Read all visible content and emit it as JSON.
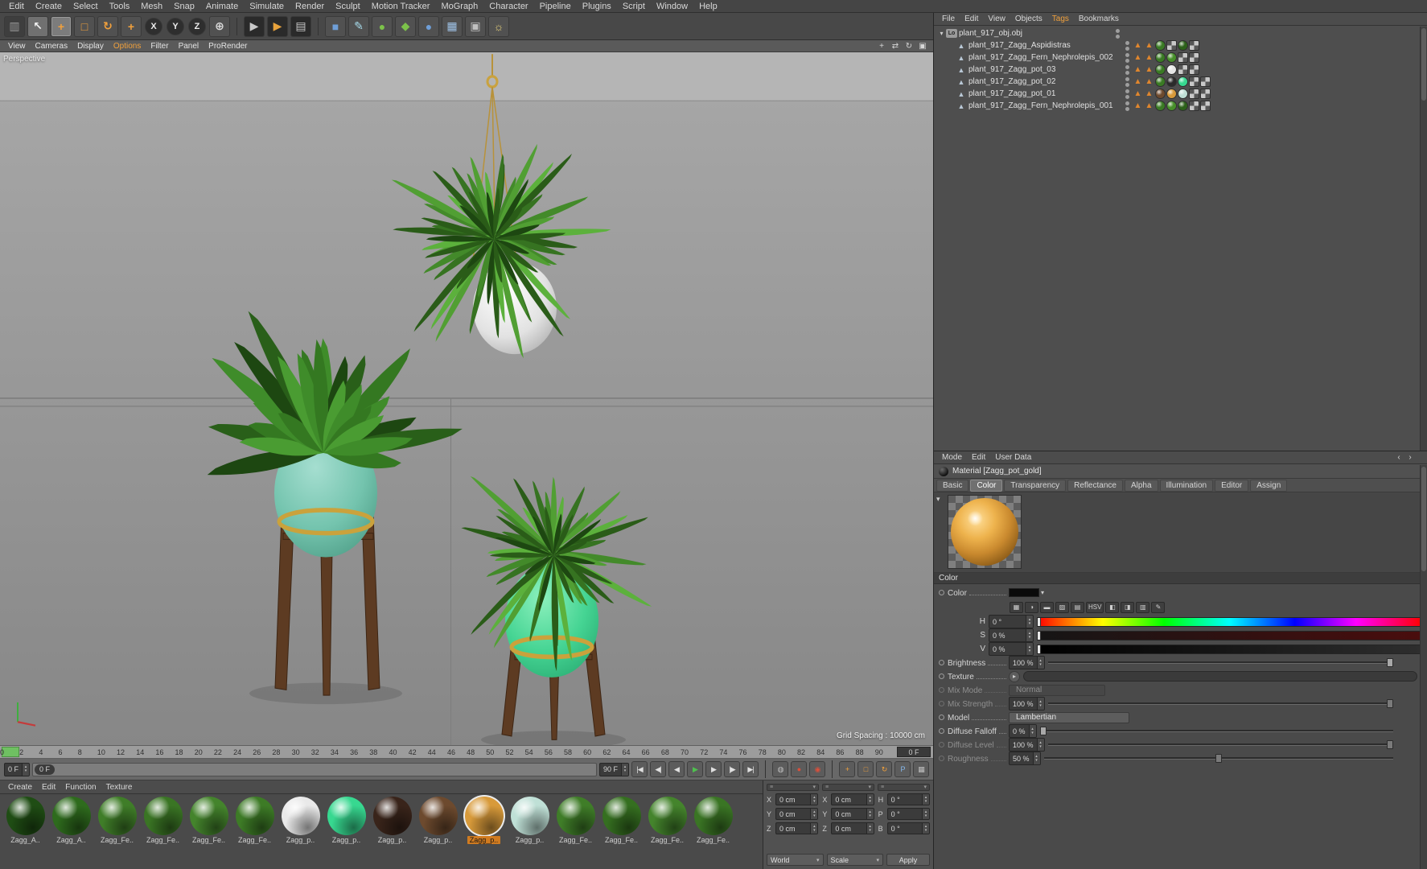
{
  "menubar": {
    "items": [
      "Edit",
      "Create",
      "Select",
      "Tools",
      "Mesh",
      "Snap",
      "Animate",
      "Simulate",
      "Render",
      "Sculpt",
      "Motion Tracker",
      "MoGraph",
      "Character",
      "Pipeline",
      "Plugins",
      "Script",
      "Window",
      "Help"
    ]
  },
  "toolbar": {
    "icons": [
      {
        "name": "paste-icon",
        "glyph": "▥",
        "fg": "#9a9a9a",
        "bg": "#3e3e3e"
      },
      {
        "name": "live-selection-tool",
        "glyph": "↖",
        "fg": "#f0f0f0",
        "bg": "#707070"
      },
      {
        "name": "move-tool",
        "glyph": "+",
        "fg": "#f2a13c",
        "bg": "#7c7c7c",
        "active": true
      },
      {
        "name": "scale-tool",
        "glyph": "□",
        "fg": "#f2a13c",
        "bg": "#515151"
      },
      {
        "name": "rotate-tool",
        "glyph": "↻",
        "fg": "#f2a13c",
        "bg": "#515151"
      },
      {
        "name": "last-used-tool",
        "glyph": "+",
        "fg": "#f2a13c",
        "bg": "#515151"
      },
      {
        "name": "lock-x-axis-button",
        "glyph": "X",
        "fg": "#ececec",
        "bg": "#2e2e2e",
        "round": true
      },
      {
        "name": "lock-y-axis-button",
        "glyph": "Y",
        "fg": "#ececec",
        "bg": "#2e2e2e",
        "round": true
      },
      {
        "name": "lock-z-axis-button",
        "glyph": "Z",
        "fg": "#ececec",
        "bg": "#2e2e2e",
        "round": true
      },
      {
        "name": "coordinate-system-button",
        "glyph": "⊕",
        "fg": "#dcdcdc",
        "bg": "#515151"
      },
      {
        "name": "sep"
      },
      {
        "name": "render-view-button",
        "glyph": "▶",
        "fg": "#c8c8c8",
        "bg": "#2a2a2a"
      },
      {
        "name": "render-picture-viewer-button",
        "glyph": "▶",
        "fg": "#e8a33c",
        "bg": "#2a2a2a"
      },
      {
        "name": "render-settings-button",
        "glyph": "▤",
        "fg": "#c8c8c8",
        "bg": "#2a2a2a"
      },
      {
        "name": "sep"
      },
      {
        "name": "add-cube-button",
        "glyph": "■",
        "fg": "#6f9fd8",
        "bg": "#515151"
      },
      {
        "name": "add-spline-button",
        "glyph": "✎",
        "fg": "#a8dcec",
        "bg": "#515151"
      },
      {
        "name": "add-mograph-button",
        "glyph": "●",
        "fg": "#7cc24a",
        "bg": "#515151"
      },
      {
        "name": "add-field-button",
        "glyph": "◆",
        "fg": "#7cc24a",
        "bg": "#515151"
      },
      {
        "name": "add-subdivision-button",
        "glyph": "●",
        "fg": "#6f9fd8",
        "bg": "#515151"
      },
      {
        "name": "add-instance-button",
        "glyph": "▦",
        "fg": "#9fc3e8",
        "bg": "#515151"
      },
      {
        "name": "add-camera-button",
        "glyph": "▣",
        "fg": "#c0c0c0",
        "bg": "#515151"
      },
      {
        "name": "add-light-button",
        "glyph": "☼",
        "fg": "#e8d27c",
        "bg": "#515151"
      }
    ]
  },
  "viewport": {
    "menu": [
      {
        "label": "View"
      },
      {
        "label": "Cameras"
      },
      {
        "label": "Display"
      },
      {
        "label": "Options",
        "active": true
      },
      {
        "label": "Filter"
      },
      {
        "label": "Panel"
      },
      {
        "label": "ProRender"
      }
    ],
    "corner_icons": [
      {
        "name": "pan-view-icon",
        "glyph": "+"
      },
      {
        "name": "dolly-view-icon",
        "glyph": "⇄"
      },
      {
        "name": "rotate-view-icon",
        "glyph": "↻"
      },
      {
        "name": "maximize-view-icon",
        "glyph": "▣"
      }
    ],
    "label": "Perspective",
    "grid_spacing": "Grid Spacing : 10000 cm"
  },
  "timeline": {
    "start": 0,
    "end": 90,
    "step": 2,
    "frame_box": "0 F"
  },
  "transport": {
    "current": "0 F",
    "bubble": "0 F",
    "end": "90 F",
    "buttons": [
      {
        "name": "goto-start-button",
        "glyph": "|◀"
      },
      {
        "name": "prev-key-button",
        "glyph": "◀|"
      },
      {
        "name": "prev-frame-button",
        "glyph": "◀"
      },
      {
        "name": "play-button",
        "glyph": "▶",
        "color": "#4fc04f"
      },
      {
        "name": "next-frame-button",
        "glyph": "▶"
      },
      {
        "name": "next-key-button",
        "glyph": "|▶"
      },
      {
        "name": "goto-end-button",
        "glyph": "▶|"
      }
    ],
    "record_buttons": [
      {
        "name": "keyframe-selection-button",
        "glyph": "◍",
        "color": "#c0c0c0"
      },
      {
        "name": "record-objects-button",
        "glyph": "●",
        "color": "#d8503c"
      },
      {
        "name": "autokeying-button",
        "glyph": "◉",
        "color": "#d8503c"
      }
    ],
    "key_toggles": [
      {
        "name": "keyframe-position-toggle",
        "glyph": "+",
        "color": "#f2a13c"
      },
      {
        "name": "keyframe-scale-toggle",
        "glyph": "□",
        "color": "#f2a13c"
      },
      {
        "name": "keyframe-rotation-toggle",
        "glyph": "↻",
        "color": "#f2a13c"
      },
      {
        "name": "keyframe-parameter-toggle",
        "glyph": "P",
        "color": "#86b8ec"
      },
      {
        "name": "keyframe-pla-toggle",
        "glyph": "▦",
        "color": "#c0c0c0"
      }
    ]
  },
  "materials": {
    "menu": [
      "Create",
      "Edit",
      "Function",
      "Texture"
    ],
    "items": [
      {
        "label": "Zagg_A..",
        "color": "#1f4d14"
      },
      {
        "label": "Zagg_A..",
        "color": "#2e6b1d"
      },
      {
        "label": "Zagg_Fe..",
        "color": "#3f7d28"
      },
      {
        "label": "Zagg_Fe..",
        "color": "#3a7524"
      },
      {
        "label": "Zagg_Fe..",
        "color": "#44842c"
      },
      {
        "label": "Zagg_Fe..",
        "color": "#3d7b26"
      },
      {
        "label": "Zagg_p..",
        "color": "#e9e9e9"
      },
      {
        "label": "Zagg_p..",
        "color": "#37d890"
      },
      {
        "label": "Zagg_p..",
        "color": "#39241a"
      },
      {
        "label": "Zagg_p..",
        "color": "#6d4a2e"
      },
      {
        "label": "Zagg_p..",
        "color": "#d89a3a",
        "selected": true
      },
      {
        "label": "Zagg_p..",
        "color": "#bfe0d6"
      },
      {
        "label": "Zagg_Fe..",
        "color": "#3f7d28"
      },
      {
        "label": "Zagg_Fe..",
        "color": "#356f20"
      },
      {
        "label": "Zagg_Fe..",
        "color": "#44842c"
      },
      {
        "label": "Zagg_Fe..",
        "color": "#3a7524"
      }
    ]
  },
  "coordinates": {
    "columns": [
      {
        "labels": [
          "X",
          "Y",
          "Z"
        ],
        "values": [
          "0 cm",
          "0 cm",
          "0 cm"
        ]
      },
      {
        "labels": [
          "X",
          "Y",
          "Z"
        ],
        "values": [
          "0 cm",
          "0 cm",
          "0 cm"
        ]
      },
      {
        "labels": [
          "H",
          "P",
          "B"
        ],
        "values": [
          "0 °",
          "0 °",
          "0 °"
        ]
      }
    ],
    "dropdowns": [
      "World",
      "Scale"
    ],
    "apply": "Apply"
  },
  "object_manager": {
    "menu": [
      {
        "label": "File"
      },
      {
        "label": "Edit"
      },
      {
        "label": "View"
      },
      {
        "label": "Objects"
      },
      {
        "label": "Tags",
        "active": true
      },
      {
        "label": "Bookmarks"
      }
    ],
    "root": {
      "label": "plant_917_obj.obj",
      "icon": "Lo"
    },
    "children": [
      {
        "label": "plant_917_Zagg_Aspidistras",
        "tags": [
          {
            "t": "tri"
          },
          {
            "t": "tri"
          },
          {
            "t": "sph",
            "c": "#3a7a24"
          },
          {
            "t": "chk"
          },
          {
            "t": "sph",
            "c": "#2c611a"
          },
          {
            "t": "chk"
          }
        ]
      },
      {
        "label": "plant_917_Zagg_Fern_Nephrolepis_002",
        "tags": [
          {
            "t": "tri"
          },
          {
            "t": "tri"
          },
          {
            "t": "sph",
            "c": "#3a7a24"
          },
          {
            "t": "sph",
            "c": "#478f2a"
          },
          {
            "t": "chk"
          },
          {
            "t": "chk"
          }
        ]
      },
      {
        "label": "plant_917_Zagg_pot_03",
        "tags": [
          {
            "t": "tri"
          },
          {
            "t": "tri"
          },
          {
            "t": "sph",
            "c": "#3a7a24"
          },
          {
            "t": "sph",
            "c": "#e6e6e6"
          },
          {
            "t": "chk"
          },
          {
            "t": "chk"
          }
        ]
      },
      {
        "label": "plant_917_Zagg_pot_02",
        "tags": [
          {
            "t": "tri"
          },
          {
            "t": "tri"
          },
          {
            "t": "sph",
            "c": "#3a7a24"
          },
          {
            "t": "sph",
            "c": "#2b2b2b"
          },
          {
            "t": "sph",
            "c": "#37d890"
          },
          {
            "t": "chk"
          },
          {
            "t": "chk"
          }
        ]
      },
      {
        "label": "plant_917_Zagg_pot_01",
        "tags": [
          {
            "t": "tri"
          },
          {
            "t": "tri"
          },
          {
            "t": "sph",
            "c": "#6d4a2e"
          },
          {
            "t": "sph",
            "c": "#d89a3a"
          },
          {
            "t": "sph",
            "c": "#bfe0d6"
          },
          {
            "t": "chk"
          },
          {
            "t": "chk"
          }
        ]
      },
      {
        "label": "plant_917_Zagg_Fern_Nephrolepis_001",
        "tags": [
          {
            "t": "tri"
          },
          {
            "t": "tri"
          },
          {
            "t": "sph",
            "c": "#3a7a24"
          },
          {
            "t": "sph",
            "c": "#478f2a"
          },
          {
            "t": "sph",
            "c": "#2c611a"
          },
          {
            "t": "chk"
          },
          {
            "t": "chk"
          }
        ]
      }
    ]
  },
  "attributes": {
    "menu": [
      "Mode",
      "Edit",
      "User Data"
    ],
    "nav_back": "‹",
    "nav_forward": "›",
    "title": "Material [Zagg_pot_gold]",
    "tabs": [
      {
        "label": "Basic"
      },
      {
        "label": "Color",
        "active": true
      },
      {
        "label": "Transparency"
      },
      {
        "label": "Reflectance"
      },
      {
        "label": "Alpha"
      },
      {
        "label": "Illumination"
      },
      {
        "label": "Editor"
      },
      {
        "label": "Assign"
      }
    ],
    "section": "Color",
    "color_row": {
      "label": "Color",
      "swatch": "#0a0a0a"
    },
    "tool_icons": [
      {
        "name": "compact-mode-icon",
        "glyph": "▦"
      },
      {
        "name": "color-wheel-icon",
        "glyph": "◑"
      },
      {
        "name": "spectrum-icon",
        "glyph": "▬"
      },
      {
        "name": "color-from-image-icon",
        "glyph": "▨"
      },
      {
        "name": "swatches-icon",
        "glyph": "▤"
      },
      {
        "name": "hsv-mode-button",
        "glyph": "HSV"
      },
      {
        "name": "rgb-sliders-icon",
        "glyph": "◧"
      },
      {
        "name": "kelvin-icon",
        "glyph": "◨"
      },
      {
        "name": "mixer-icon",
        "glyph": "▥"
      },
      {
        "name": "color-picker-icon",
        "glyph": "✎"
      }
    ],
    "hsv": [
      {
        "label": "H",
        "value": "0 °",
        "bar": "hue"
      },
      {
        "label": "S",
        "value": "0 %",
        "bar": "sat"
      },
      {
        "label": "V",
        "value": "0 %",
        "bar": "val"
      }
    ],
    "props": [
      {
        "label": "Brightness",
        "value": "100 %",
        "type": "slider",
        "pos": 1,
        "enabled": true
      },
      {
        "label": "Texture",
        "value": "",
        "type": "texture",
        "enabled": true
      },
      {
        "label": "Mix Mode",
        "value": "Normal",
        "type": "dropdown",
        "enabled": false
      },
      {
        "label": "Mix Strength",
        "value": "100 %",
        "type": "slider",
        "pos": 1,
        "enabled": false
      },
      {
        "label": "Model",
        "value": "Lambertian",
        "type": "dropdown",
        "enabled": true
      },
      {
        "label": "Diffuse Falloff",
        "value": "0 %",
        "type": "slider",
        "pos": 0,
        "enabled": true
      },
      {
        "label": "Diffuse Level",
        "value": "100 %",
        "type": "slider",
        "pos": 1,
        "enabled": false
      },
      {
        "label": "Roughness",
        "value": "50 %",
        "type": "slider",
        "pos": 0.5,
        "enabled": false
      }
    ]
  }
}
